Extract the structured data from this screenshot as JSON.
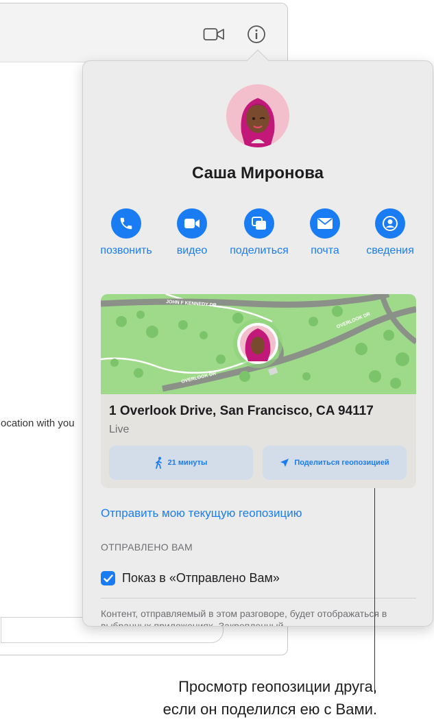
{
  "background_window": {
    "snippet_text": "ocation with you",
    "video_icon": "video-camera-icon",
    "info_icon": "info-icon"
  },
  "popover": {
    "contact_name": "Саша Миронова",
    "avatar_icon": "memoji-avatar",
    "actions": [
      {
        "label": "позвонить",
        "icon": "phone-icon"
      },
      {
        "label": "видео",
        "icon": "video-icon"
      },
      {
        "label": "поделиться",
        "icon": "share-screen-icon"
      },
      {
        "label": "почта",
        "icon": "mail-icon"
      },
      {
        "label": "сведения",
        "icon": "person-info-icon"
      }
    ],
    "location": {
      "map_streets": [
        "JOHN F KENNEDY DR",
        "OVERLOOK DR",
        "OVERLOOK DR"
      ],
      "address": "1 Overlook Drive, San Francisco, CA 94117",
      "status": "Live",
      "walk_button": "21 минуты",
      "share_button": "Поделиться геопозицией"
    },
    "send_location_link": "Отправить мою текущую геопозицию",
    "shared_with_you_header": "ОТПРАВЛЕНО ВАМ",
    "show_in_shared": {
      "label": "Показ в «Отправлено Вам»",
      "checked": true
    },
    "footnote": "Контент, отправляемый в этом разговоре, будет отображаться в выбранных приложениях. Закрепленный"
  },
  "callout": {
    "line1": "Просмотр геопозиции друга,",
    "line2": "если он поделился ею с Вами."
  },
  "colors": {
    "accent": "#1a7cf2",
    "popover_bg": "#ececec",
    "map_green": "#9fd98a"
  }
}
